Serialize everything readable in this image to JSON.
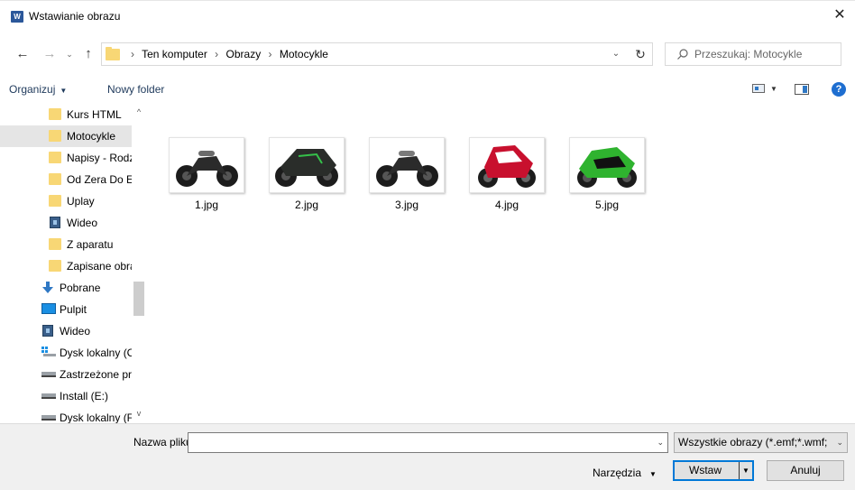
{
  "window": {
    "title": "Wstawianie obrazu",
    "app_icon_letter": "W",
    "close_glyph": "✕"
  },
  "nav": {
    "back_glyph": "←",
    "forward_glyph": "→",
    "recent_glyph": "⌄",
    "up_glyph": "↑",
    "breadcrumb": [
      "Ten komputer",
      "Obrazy",
      "Motocykle"
    ],
    "separator": "›",
    "refresh_glyph": "↻",
    "dropdown_glyph": "⌄",
    "search_placeholder": "Przeszukaj: Motocykle"
  },
  "toolbar": {
    "organize_label": "Organizuj",
    "organize_dd": "▼",
    "new_folder_label": "Nowy folder",
    "view_dd": "▼",
    "help_glyph": "?"
  },
  "sidebar": {
    "items": [
      {
        "label": "Kurs HTML",
        "icon": "folder-icon"
      },
      {
        "label": "Motocykle",
        "icon": "folder-icon",
        "selected": true
      },
      {
        "label": "Napisy - Rodz",
        "icon": "folder-icon"
      },
      {
        "label": "Od Zera Do E",
        "icon": "folder-icon"
      },
      {
        "label": "Uplay",
        "icon": "folder-icon"
      },
      {
        "label": "Wideo",
        "icon": "video-icon"
      },
      {
        "label": "Z aparatu",
        "icon": "folder-icon"
      },
      {
        "label": "Zapisane obra",
        "icon": "folder-icon"
      },
      {
        "label": "Pobrane",
        "icon": "download-icon"
      },
      {
        "label": "Pulpit",
        "icon": "desktop-icon"
      },
      {
        "label": "Wideo",
        "icon": "video-icon"
      },
      {
        "label": "Dysk lokalny (C",
        "icon": "os-drive-icon"
      },
      {
        "label": "Zastrzeżone prz",
        "icon": "drive-icon"
      },
      {
        "label": "Install (E:)",
        "icon": "drive-icon"
      },
      {
        "label": "Dysk lokalny (F",
        "icon": "drive-icon"
      }
    ],
    "scroll_up_glyph": "^",
    "scroll_down_glyph": "v"
  },
  "files": [
    {
      "name": "1.jpg",
      "color": "#2b2b2b",
      "accent": "#6b6b6b"
    },
    {
      "name": "2.jpg",
      "color": "#2a2d2a",
      "accent": "#35c24a"
    },
    {
      "name": "3.jpg",
      "color": "#2b2b2b",
      "accent": "#7a7a7a"
    },
    {
      "name": "4.jpg",
      "color": "#c8102e",
      "accent": "#ffffff"
    },
    {
      "name": "5.jpg",
      "color": "#2fb32f",
      "accent": "#111111"
    }
  ],
  "bottom": {
    "filename_label": "Nazwa pliku:",
    "filename_value": "",
    "filename_dd": "⌄",
    "filter_label": "Wszystkie obrazy (*.emf;*.wmf;",
    "filter_dd": "⌄",
    "tools_label": "Narzędzia",
    "tools_dd": "▼",
    "insert_label": "Wstaw",
    "insert_dd": "▼",
    "cancel_label": "Anuluj"
  },
  "colors": {
    "accent": "#0078d7",
    "selection": "#e5e5e5",
    "folder": "#f8d775"
  }
}
